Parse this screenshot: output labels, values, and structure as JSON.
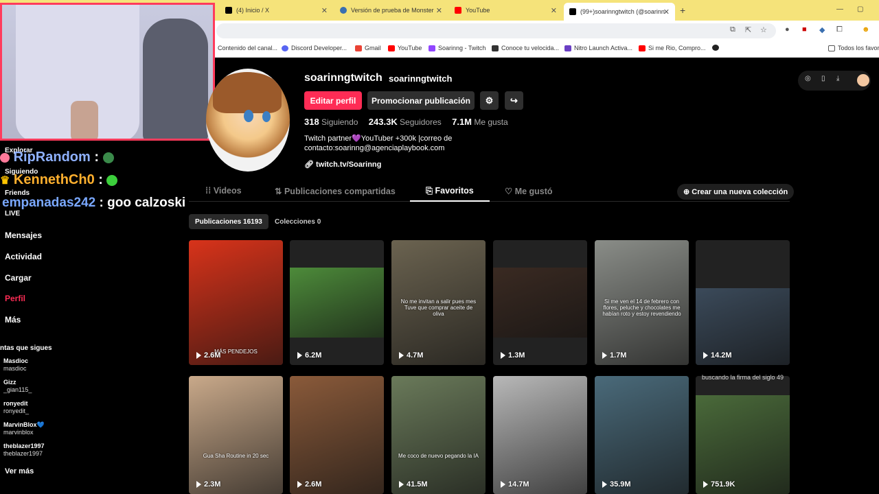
{
  "browser": {
    "tabs": [
      {
        "label": "(4) Inicio / X",
        "color": "#000000"
      },
      {
        "label": "Versión de prueba de Monster",
        "color": "#3a6fb0"
      },
      {
        "label": "YouTube",
        "color": "#ff0000"
      },
      {
        "label": "(99+)soarinngtwitch (@soarinn",
        "color": "#000000"
      }
    ],
    "bookmarks": [
      {
        "label": "Contenido del canal...",
        "color": "#ffffff"
      },
      {
        "label": "Discord Developer...",
        "color": "#5865f2"
      },
      {
        "label": "Gmail",
        "color": "#ea4335"
      },
      {
        "label": "YouTube",
        "color": "#ff0000"
      },
      {
        "label": "Soarinng - Twitch",
        "color": "#9146ff"
      },
      {
        "label": "Conoce tu velocida...",
        "color": "#333333"
      },
      {
        "label": "Nitro Launch Activa...",
        "color": "#6a3fc4"
      },
      {
        "label": "Si me Rio, Compro...",
        "color": "#ff0000"
      },
      {
        "label": "",
        "color": "#222222"
      },
      {
        "label": "Todos los favori",
        "color": "#ffffff"
      }
    ]
  },
  "chat": [
    {
      "user": "RipRandom",
      "sep": " : ",
      "msg": ""
    },
    {
      "user": "KennethCh0",
      "sep": " : ",
      "msg": ""
    },
    {
      "user": "empanadas242",
      "sep": " : ",
      "msg": "goo calzoski"
    }
  ],
  "sidebar": {
    "small_items": [
      "Explorar",
      "Siguiendo",
      "Friends",
      "LIVE"
    ],
    "items": [
      {
        "label": "Mensajes",
        "active": false
      },
      {
        "label": "Actividad",
        "active": false
      },
      {
        "label": "Cargar",
        "active": false
      },
      {
        "label": "Perfil",
        "active": true
      },
      {
        "label": "Más",
        "active": false
      }
    ],
    "following_title": "ntas que sigues",
    "following": [
      {
        "name": "Masdioc",
        "handle": "masdioc"
      },
      {
        "name": "Gizz",
        "handle": "_gian115_"
      },
      {
        "name": "ronyedit",
        "handle": "ronyedit_"
      },
      {
        "name": "MarvinBlox💙",
        "handle": "marvinblox"
      },
      {
        "name": "theblazer1997",
        "handle": "theblazer1997"
      }
    ],
    "see_more": "Ver más"
  },
  "profile": {
    "username": "soarinngtwitch",
    "nickname": "soarinngtwitch",
    "edit_button": "Editar perfil",
    "promote_button": "Promocionar publicación",
    "stats": [
      {
        "value": "318",
        "label": "Siguiendo"
      },
      {
        "value": "243.3K",
        "label": "Seguidores"
      },
      {
        "value": "7.1M",
        "label": "Me gusta"
      }
    ],
    "bio_line1": "Twitch partner💜YouTuber +300k |correo de",
    "bio_line2": "contacto:soarinng@agenciaplaybook.com",
    "link": "twitch.tv/Soarinng"
  },
  "tabs": [
    {
      "label": "Videos",
      "icon": "grid-icon"
    },
    {
      "label": "Publicaciones compartidas",
      "icon": "repost-icon"
    },
    {
      "label": "Favoritos",
      "icon": "bookmark-icon"
    },
    {
      "label": "Me gustó",
      "icon": "heart-icon"
    }
  ],
  "new_collection": "Crear una nueva colección",
  "subtabs": [
    {
      "label": "Publicaciones 16193"
    },
    {
      "label": "Colecciones 0"
    }
  ],
  "videos": [
    {
      "views": "2.6M",
      "caption": "MÁS PENDEJOS",
      "bg": "#d8331a"
    },
    {
      "views": "6.2M",
      "caption": "",
      "bg": "#4d8b3a"
    },
    {
      "views": "4.7M",
      "caption": "No me invitan a salir pues mes Tuve que comprar aceite de oliva",
      "bg": "#6b6350"
    },
    {
      "views": "1.3M",
      "caption": "",
      "bg": "#3a2a22"
    },
    {
      "views": "1.7M",
      "caption": "Si me ven el 14 de febrero con flores, peluche y chocolates me habían roto y estoy revendiendo",
      "bg": "#8a8d88"
    },
    {
      "views": "14.2M",
      "caption": "",
      "bg": "#3b4a5a"
    },
    {
      "views": "2.3M",
      "caption": "Gua Sha Routine in 20 sec",
      "bg": "#c9a98a"
    },
    {
      "views": "2.6M",
      "caption": "",
      "bg": "#8a5a3a"
    },
    {
      "views": "41.5M",
      "caption": "Me coco de nuevo pegando la IA",
      "bg": "#6a7a5a"
    },
    {
      "views": "14.7M",
      "caption": "",
      "bg": "#b8b8b8"
    },
    {
      "views": "35.9M",
      "caption": "",
      "bg": "#4a6a7a"
    },
    {
      "views": "751.9K",
      "caption": "",
      "bg": "#4a6a3a"
    }
  ],
  "last_top_caption": "buscando la firma del siglo 49"
}
